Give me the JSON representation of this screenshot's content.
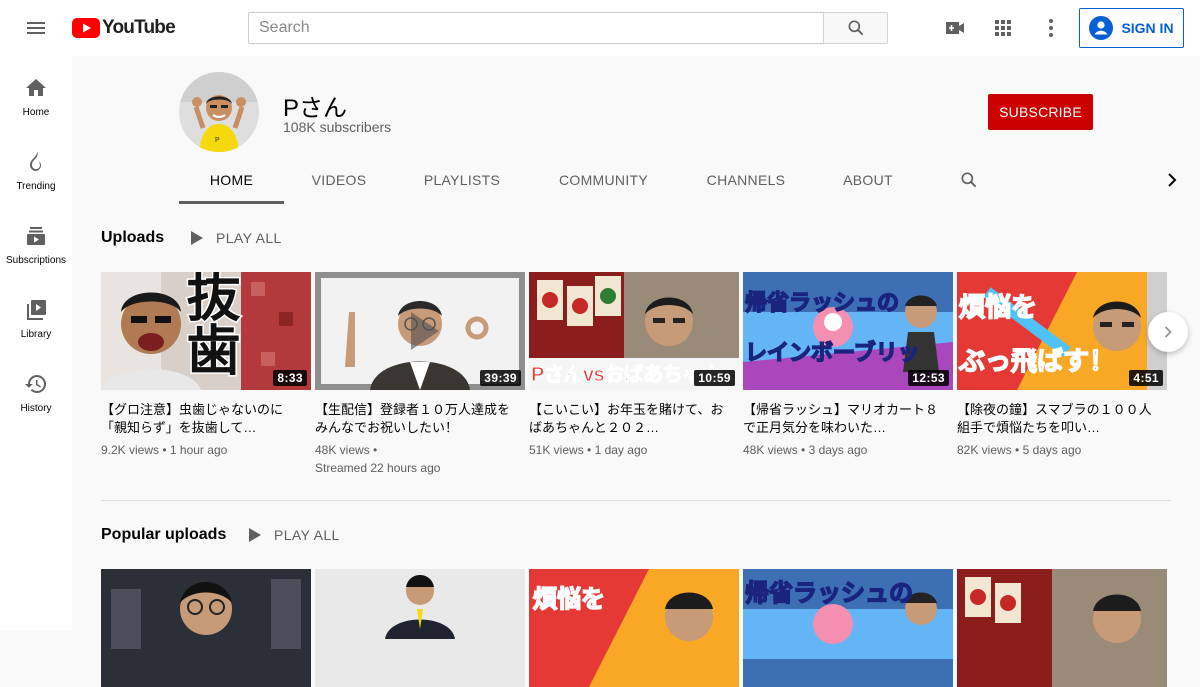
{
  "masthead": {
    "logo_text": "YouTube",
    "search_placeholder": "Search",
    "sign_in_label": "SIGN IN",
    "icons": [
      "menu-icon",
      "youtube-logo-icon",
      "search-icon",
      "create-video-icon",
      "apps-grid-icon",
      "more-vert-icon",
      "account-circle-icon"
    ]
  },
  "guide": {
    "items": [
      {
        "label": "Home",
        "icon": "home-icon"
      },
      {
        "label": "Trending",
        "icon": "flame-icon"
      },
      {
        "label": "Subscriptions",
        "icon": "subscriptions-icon"
      },
      {
        "label": "Library",
        "icon": "library-icon"
      },
      {
        "label": "History",
        "icon": "history-icon"
      }
    ]
  },
  "channel": {
    "name": "Pさん",
    "subscribers": "108K subscribers",
    "subscribe_label": "SUBSCRIBE",
    "tabs": [
      "HOME",
      "VIDEOS",
      "PLAYLISTS",
      "COMMUNITY",
      "CHANNELS",
      "ABOUT"
    ],
    "active_tab": "HOME"
  },
  "shelves": [
    {
      "title": "Uploads",
      "play_all": "PLAY ALL",
      "videos": [
        {
          "title": "【グロ注意】虫歯じゃないのに「親知らず」を抜歯して…",
          "views": "9.2K views",
          "age": "1 hour ago",
          "duration": "8:33",
          "thumb_text": "抜歯"
        },
        {
          "title": "【生配信】登録者１０万人達成をみんなでお祝いしたい！",
          "views": "48K views",
          "age": "Streamed 22 hours ago",
          "duration": "39:39",
          "thumb_text": ""
        },
        {
          "title": "【こいこい】お年玉を賭けて、おばあちゃんと２０２…",
          "views": "51K views",
          "age": "1 day ago",
          "duration": "10:59",
          "thumb_text": "Pさんvsおばあちゃん"
        },
        {
          "title": "【帰省ラッシュ】マリオカート８で正月気分を味わいた…",
          "views": "48K views",
          "age": "3 days ago",
          "duration": "12:53",
          "thumb_text": "帰省ラッシュの レインボーブリッジ"
        },
        {
          "title": "【除夜の鐘】スマブラの１００人組手で煩悩たちを叩い…",
          "views": "82K views",
          "age": "5 days ago",
          "duration": "4:51",
          "thumb_text": "煩悩を ぶっ飛ばす！"
        }
      ]
    },
    {
      "title": "Popular uploads",
      "play_all": "PLAY ALL",
      "videos": [
        {
          "thumb_text": ""
        },
        {
          "thumb_text": ""
        },
        {
          "thumb_text": "煩悩を"
        },
        {
          "thumb_text": "帰省ラッシュの"
        },
        {
          "thumb_text": ""
        }
      ]
    }
  ],
  "colors": {
    "brand_red": "#ff0000",
    "subscribe_red": "#cc0000",
    "link_blue": "#065fd4",
    "text_primary": "#030303",
    "text_secondary": "#606060"
  }
}
